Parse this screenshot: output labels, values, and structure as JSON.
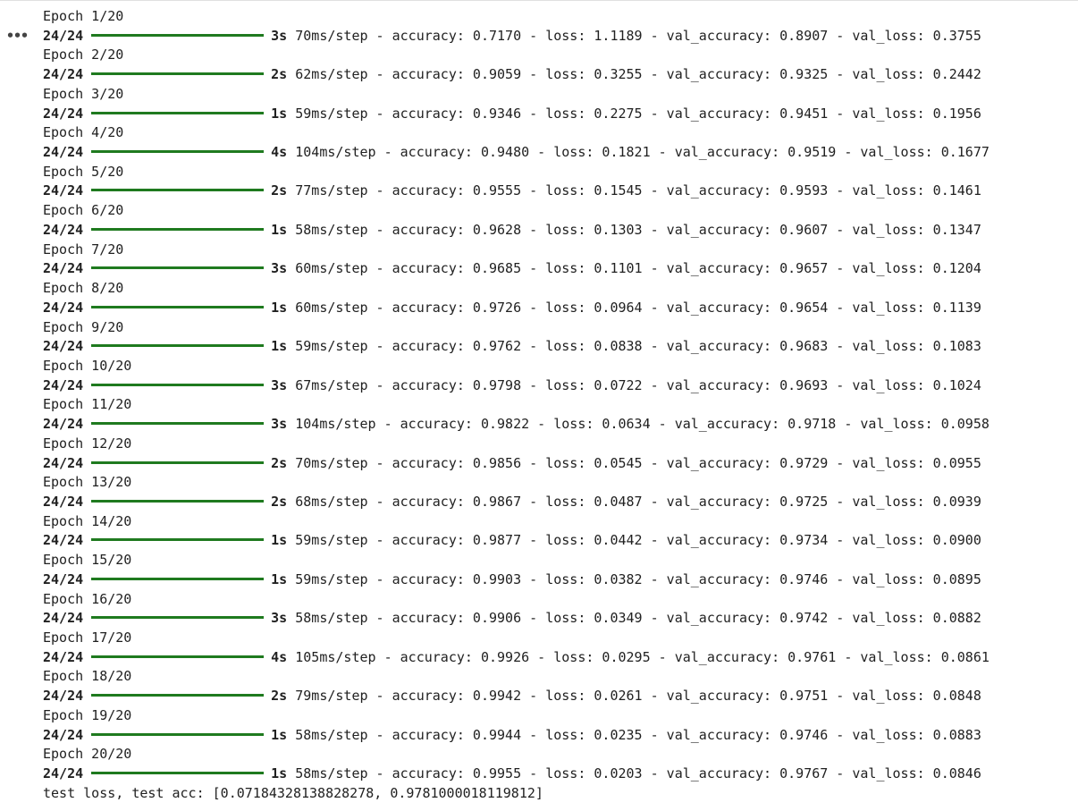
{
  "output_menu_label": "•••",
  "epochs": [
    {
      "header": "Epoch 1/20",
      "steps": "24/24",
      "duration": "3s",
      "details": "70ms/step - accuracy: 0.7170 - loss: 1.1189 - val_accuracy: 0.8907 - val_loss: 0.3755"
    },
    {
      "header": "Epoch 2/20",
      "steps": "24/24",
      "duration": "2s",
      "details": "62ms/step - accuracy: 0.9059 - loss: 0.3255 - val_accuracy: 0.9325 - val_loss: 0.2442"
    },
    {
      "header": "Epoch 3/20",
      "steps": "24/24",
      "duration": "1s",
      "details": "59ms/step - accuracy: 0.9346 - loss: 0.2275 - val_accuracy: 0.9451 - val_loss: 0.1956"
    },
    {
      "header": "Epoch 4/20",
      "steps": "24/24",
      "duration": "4s",
      "details": "104ms/step - accuracy: 0.9480 - loss: 0.1821 - val_accuracy: 0.9519 - val_loss: 0.1677"
    },
    {
      "header": "Epoch 5/20",
      "steps": "24/24",
      "duration": "2s",
      "details": "77ms/step - accuracy: 0.9555 - loss: 0.1545 - val_accuracy: 0.9593 - val_loss: 0.1461"
    },
    {
      "header": "Epoch 6/20",
      "steps": "24/24",
      "duration": "1s",
      "details": "58ms/step - accuracy: 0.9628 - loss: 0.1303 - val_accuracy: 0.9607 - val_loss: 0.1347"
    },
    {
      "header": "Epoch 7/20",
      "steps": "24/24",
      "duration": "3s",
      "details": "60ms/step - accuracy: 0.9685 - loss: 0.1101 - val_accuracy: 0.9657 - val_loss: 0.1204"
    },
    {
      "header": "Epoch 8/20",
      "steps": "24/24",
      "duration": "1s",
      "details": "60ms/step - accuracy: 0.9726 - loss: 0.0964 - val_accuracy: 0.9654 - val_loss: 0.1139"
    },
    {
      "header": "Epoch 9/20",
      "steps": "24/24",
      "duration": "1s",
      "details": "59ms/step - accuracy: 0.9762 - loss: 0.0838 - val_accuracy: 0.9683 - val_loss: 0.1083"
    },
    {
      "header": "Epoch 10/20",
      "steps": "24/24",
      "duration": "3s",
      "details": "67ms/step - accuracy: 0.9798 - loss: 0.0722 - val_accuracy: 0.9693 - val_loss: 0.1024"
    },
    {
      "header": "Epoch 11/20",
      "steps": "24/24",
      "duration": "3s",
      "details": "104ms/step - accuracy: 0.9822 - loss: 0.0634 - val_accuracy: 0.9718 - val_loss: 0.0958"
    },
    {
      "header": "Epoch 12/20",
      "steps": "24/24",
      "duration": "2s",
      "details": "70ms/step - accuracy: 0.9856 - loss: 0.0545 - val_accuracy: 0.9729 - val_loss: 0.0955"
    },
    {
      "header": "Epoch 13/20",
      "steps": "24/24",
      "duration": "2s",
      "details": "68ms/step - accuracy: 0.9867 - loss: 0.0487 - val_accuracy: 0.9725 - val_loss: 0.0939"
    },
    {
      "header": "Epoch 14/20",
      "steps": "24/24",
      "duration": "1s",
      "details": "59ms/step - accuracy: 0.9877 - loss: 0.0442 - val_accuracy: 0.9734 - val_loss: 0.0900"
    },
    {
      "header": "Epoch 15/20",
      "steps": "24/24",
      "duration": "1s",
      "details": "59ms/step - accuracy: 0.9903 - loss: 0.0382 - val_accuracy: 0.9746 - val_loss: 0.0895"
    },
    {
      "header": "Epoch 16/20",
      "steps": "24/24",
      "duration": "3s",
      "details": "58ms/step - accuracy: 0.9906 - loss: 0.0349 - val_accuracy: 0.9742 - val_loss: 0.0882"
    },
    {
      "header": "Epoch 17/20",
      "steps": "24/24",
      "duration": "4s",
      "details": "105ms/step - accuracy: 0.9926 - loss: 0.0295 - val_accuracy: 0.9761 - val_loss: 0.0861"
    },
    {
      "header": "Epoch 18/20",
      "steps": "24/24",
      "duration": "2s",
      "details": "79ms/step - accuracy: 0.9942 - loss: 0.0261 - val_accuracy: 0.9751 - val_loss: 0.0848"
    },
    {
      "header": "Epoch 19/20",
      "steps": "24/24",
      "duration": "1s",
      "details": "58ms/step - accuracy: 0.9944 - loss: 0.0235 - val_accuracy: 0.9746 - val_loss: 0.0883"
    },
    {
      "header": "Epoch 20/20",
      "steps": "24/24",
      "duration": "1s",
      "details": "58ms/step - accuracy: 0.9955 - loss: 0.0203 - val_accuracy: 0.9767 - val_loss: 0.0846"
    }
  ],
  "test_result": "test loss, test acc: [0.07184328138828278, 0.9781000018119812]",
  "colors": {
    "progress_bar": "#1f7a1f",
    "text": "#212121"
  }
}
